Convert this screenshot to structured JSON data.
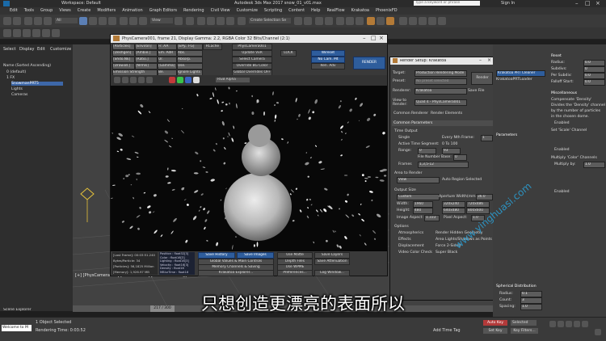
{
  "titlebar": {
    "workspace": "Workspace: Default",
    "title": "Autodesk 3ds Max 2017    snow_01_v01.max",
    "search_placeholder": "Type a keyword or phrase",
    "signin": "Sign In"
  },
  "menu": [
    "Edit",
    "Tools",
    "Group",
    "Views",
    "Create",
    "Modifiers",
    "Animation",
    "Graph Editors",
    "Rendering",
    "Civil View",
    "Customize",
    "Scripting",
    "Content",
    "Help",
    "RealFlow",
    "Krakatoa",
    "PhoenixFD"
  ],
  "toolbar": {
    "view_dropdown": "View",
    "selection_set": "Create Selection Se"
  },
  "viewport_label": "[+] [PhysCamera001] [User Defined] [Default Shading]",
  "scene_explorer": {
    "tabs": [
      "Select",
      "Display",
      "Edit",
      "Customize"
    ],
    "sort_label": "Name (Sorted Ascending)",
    "items": [
      "0 (default)",
      "1 FX",
      "SnowmanPRT5",
      "Lights",
      "Cameras"
    ],
    "footer": "Scene Explorer"
  },
  "render_window": {
    "title": "PhysCamera001, frame 21, Display Gamma: 2.2, RGBA Color 32 Bits/Channel (2:1)",
    "rows": [
      [
        "[Particles]",
        "[Environ]",
        "Fr. AA",
        "[EPy.. FG]",
        "RCache",
        "PhysCamera001"
      ],
      [
        "[Deshgen]",
        "[Ambie.]",
        "Em. AdR",
        "Abs.",
        "Update VxR",
        "Wireset"
      ],
      [
        "[Shdo.Nk]",
        "[Ratio.]",
        "Ur.",
        "Absorp.",
        "Select Camera",
        "No Cam. Mt"
      ],
      [
        "[Draw.Bl.]",
        "[Nrmls]",
        "[Gamma]",
        "Use.",
        "Override BG Color",
        "Ren. Adv"
      ],
      [
        "Emission Strength",
        "Be.",
        "Ignore Lights",
        "Global Overrides OFF"
      ]
    ],
    "lock_label": "LOCK",
    "render_btn": "RENDER",
    "channel": "RGB Alpha",
    "stats": {
      "left": [
        "[Last Frame]: 00:03:51.240",
        "Bytes/Particle: 34",
        "[Particles]: 56,1825 Million",
        "[Memory]: 1,926.97 MB"
      ],
      "channels": [
        "Position : float32[3]",
        "Color : float16[3]",
        "Lighting : float16[3]",
        "Velocity : float16[3]",
        "Density : float16",
        "MBlurTime : float16"
      ],
      "buttons": [
        "Save History",
        "Save Images",
        "Global Values & Main Controls",
        "Memory Channels & Saving",
        "Krakatoa Explorer...",
        "Log Window..."
      ],
      "buttons_right": [
        "Use Matte",
        "Save Layers",
        "Depth Files",
        "Save Attenuation",
        "Use WPME",
        "Preferences..."
      ]
    }
  },
  "render_setup": {
    "title": "Render Setup: Krakatoa",
    "target_label": "Target:",
    "target": "Production Rendering Mode",
    "preset_label": "Preset:",
    "preset": "No preset selected",
    "renderer_label": "Renderer:",
    "renderer": "Krakatoa",
    "save_file": "Save File",
    "render_btn": "Render",
    "view_label": "View to Render:",
    "view": "Quad 4 - PhysCamera001",
    "tabs": [
      "Common",
      "Renderer",
      "Render Elements"
    ],
    "section": "Common Parameters",
    "time_output": "Time Output",
    "single": "Single",
    "every_nth": "Every Nth Frame:",
    "nth_val": "1",
    "active_segment": "Active Time Segment:",
    "active_range": "0 To 100",
    "range_label": "Range:",
    "range_from": "0",
    "range_to": "93",
    "file_base": "File Number Base:",
    "file_base_val": "0",
    "frames_label": "Frames",
    "frames": "1,3,5-12",
    "area_label": "Area to Render",
    "area": "View",
    "auto_region": "Auto Region Selected",
    "output_size": "Output Size",
    "custom": "Custom",
    "aperture": "Aperture Width(mm):",
    "aperture_val": "36.0",
    "width_label": "Width:",
    "width": "1960",
    "height_label": "Height:",
    "height": "480",
    "presets": [
      "320x240",
      "720x486",
      "640x480",
      "800x600"
    ],
    "image_aspect": "Image Aspect:",
    "image_aspect_val": "1.333",
    "pixel_aspect": "Pixel Aspect:",
    "pixel_aspect_val": "1.0",
    "options": "Options",
    "checks": [
      "Atmospherics",
      "Render Hidden Geometry",
      "Effects",
      "Area Lights/Shadows as Points",
      "Displacement",
      "Force 2-Sided",
      "Video Color Check",
      "Super Black"
    ]
  },
  "command_panel": {
    "reset_btn": "Krakatoa PRT Cleaner",
    "list_item": "KrakatoaPRTLoader",
    "items_top": [
      "Reset",
      "Radius:",
      "Subdivs:",
      "Per Subdiv:",
      "Falloff Start:"
    ],
    "values_top": [
      "0.0",
      "0",
      "0.0",
      "0.0"
    ],
    "section_misc": "Miscellaneous",
    "misc_lines": [
      "Compensate 'Density'",
      "Divides the 'Density' channel",
      "by the number of particles",
      "in the chosen dome."
    ],
    "enabled": "Enabled",
    "scale_channel": "Set 'Scale' Channel",
    "multiply": "Multiply 'Color' Channels",
    "multiply_by": "Multiply by:",
    "multiply_val": "1.0",
    "parameters": "Parameters",
    "spherical": "Spherical Distribution",
    "radius": "Radius:",
    "radius_val": "0.1",
    "count": "Count:",
    "count_val": "3",
    "spacing": "Spacing:",
    "spacing_val": "1.0",
    "key_filters": "Key Filters..."
  },
  "status": {
    "objects": "1 Object Selected",
    "render_time": "Rendering Time: 0:03:52",
    "welcome": "Welcome to M",
    "frame_label": "217 / 300",
    "add_time_tag": "Add Time Tag",
    "selected": "Selected",
    "auto_key": "Auto Key",
    "set_key": "Set Key"
  },
  "subtitle": "只想创造更漂亮的表面所以",
  "watermark": "www.yinghuasi.com",
  "colors": {
    "accent": "#3d67a8",
    "subtitle": "#ffffff",
    "watermark": "#2aa0d6"
  }
}
